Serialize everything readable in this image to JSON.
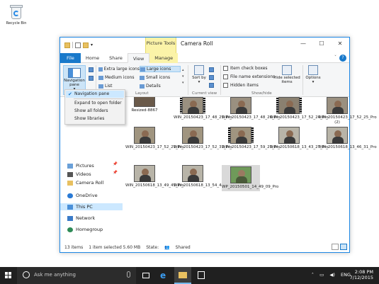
{
  "desktop": {
    "recycle_bin_label": "Recycle Bin"
  },
  "window": {
    "title": "Camera Roll",
    "context_tab_group": "Picture Tools",
    "tabs": [
      "File",
      "Home",
      "Share",
      "View",
      "Manage"
    ],
    "active_tab": "View"
  },
  "ribbon": {
    "navigation_pane_label": "Navigation pane",
    "layout_items": [
      "Extra large icons",
      "Large icons",
      "Medium icons",
      "Small icons",
      "List",
      "Details"
    ],
    "selected_layout": "Large icons",
    "layout_group_label": "Layout",
    "sort_by_label": "Sort by",
    "current_view_group_label": "Current view",
    "checkboxes": [
      "Item check boxes",
      "File name extensions",
      "Hidden items"
    ],
    "hide_selected_label": "Hide selected items",
    "options_label": "Options",
    "show_hide_group_label": "Show/hide"
  },
  "dropdown": {
    "items": [
      "Navigation pane",
      "Expand to open folder",
      "Show all folders",
      "Show libraries"
    ],
    "checked": "Navigation pane"
  },
  "navpane": {
    "items": [
      "Pictures",
      "Videos",
      "Camera Roll",
      "OneDrive",
      "This PC",
      "Network",
      "Homegroup"
    ],
    "selected": "This PC"
  },
  "files": [
    {
      "name": "Resized-8867",
      "video": false
    },
    {
      "name": "WIN_20150423_17_48_25_Pro",
      "video": true
    },
    {
      "name": "WIN_20150423_17_48_26_Pro",
      "video": false
    },
    {
      "name": "WIN_20150423_17_52_24_Pro",
      "video": true
    },
    {
      "name": "WIN_20150423_17_52_25_Pro (2)",
      "video": false
    },
    {
      "name": "WIN_20150423_17_52_25_Pro",
      "video": false
    },
    {
      "name": "WIN_20150423_17_52_33_Pro",
      "video": false
    },
    {
      "name": "WIN_20150423_17_59_25_Pro",
      "video": true
    },
    {
      "name": "WIN_20150618_13_43_27_Pro",
      "video": false
    },
    {
      "name": "WIN_20150618_13_46_31_Pro",
      "video": false
    },
    {
      "name": "WIN_20150618_13_49_45_Pro",
      "video": false
    },
    {
      "name": "WIN_20150618_13_54_48_Pro",
      "video": false
    },
    {
      "name": "WP_20150501_14_49_09_Pro",
      "video": false
    }
  ],
  "selected_file": "WP_20150501_14_49_09_Pro",
  "status": {
    "item_count": "13 items",
    "selection": "1 item selected  5.60 MB",
    "state_label": "State:",
    "state_value": "Shared"
  },
  "taskbar": {
    "search_placeholder": "Ask me anything",
    "language": "ENG",
    "time": "2:08 PM",
    "date": "7/12/2015"
  },
  "colors": {
    "accent": "#1979ca",
    "context_tab": "#fbf3a8",
    "taskbar": "#202020"
  }
}
